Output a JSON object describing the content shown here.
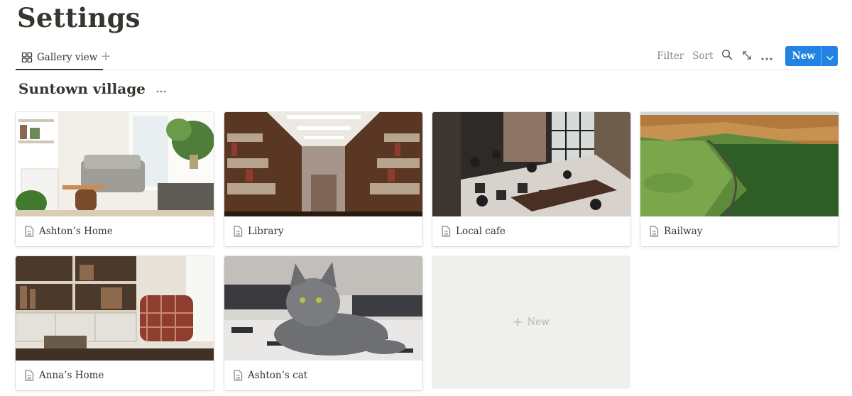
{
  "page": {
    "title": "Settings"
  },
  "toolbar": {
    "view_tab_label": "Gallery view",
    "filter_label": "Filter",
    "sort_label": "Sort",
    "new_button_label": "New",
    "accent_color": "#2383e2"
  },
  "group": {
    "title": "Suntown village"
  },
  "cards": [
    {
      "name": "Ashton’s Home",
      "cover": "living-room-photo"
    },
    {
      "name": "Library",
      "cover": "library-bookshelves-photo"
    },
    {
      "name": "Local cafe",
      "cover": "cafe-interior-photo"
    },
    {
      "name": "Railway",
      "cover": "railway-valley-photo"
    },
    {
      "name": "Anna’s Home",
      "cover": "bookcase-armchair-photo"
    },
    {
      "name": "Ashton’s cat",
      "cover": "grey-cat-photo"
    }
  ],
  "new_card": {
    "label": "New"
  },
  "icons": {
    "view_tab": "gallery-grid-icon",
    "add_view": "plus-icon",
    "search": "search-icon",
    "expand": "expand-icon",
    "more": "more-horizontal-icon",
    "dropdown": "chevron-down-icon",
    "page": "page-document-icon"
  }
}
